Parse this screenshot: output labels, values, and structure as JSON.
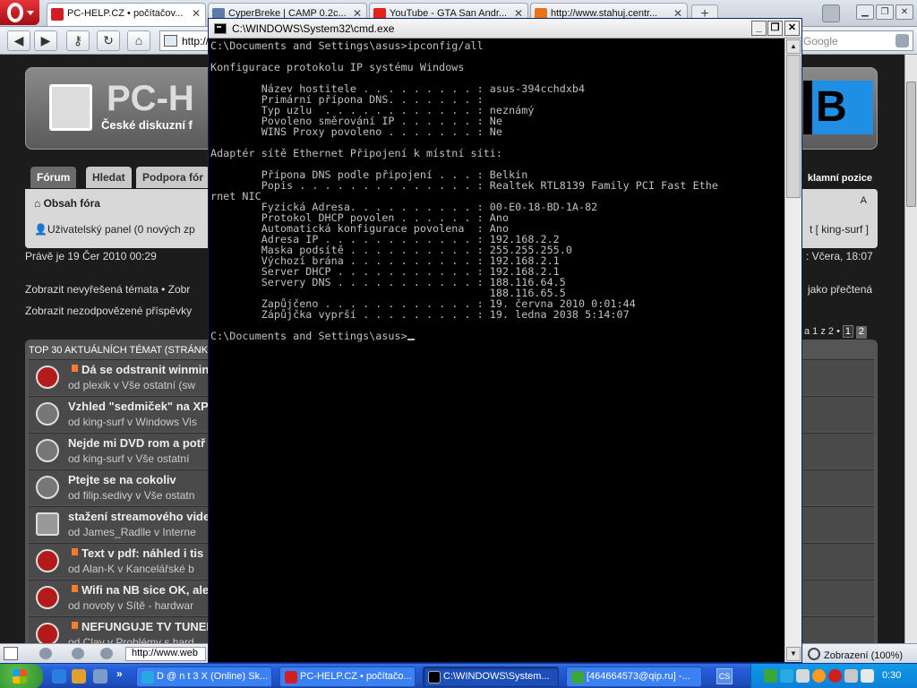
{
  "browser": {
    "tabs": [
      {
        "label": "PC-HELP.CZ • počítačov...",
        "active": true
      },
      {
        "label": "CyperBreke | CAMP 0.2c...",
        "active": false
      },
      {
        "label": "YouTube - GTA San Andr...",
        "active": false
      },
      {
        "label": "http://www.stahuj.centr...",
        "active": false
      }
    ],
    "address": "http://",
    "search_placeholder": "Google",
    "status_url": "http://www.web",
    "zoom": "Zobrazení (100%)"
  },
  "website": {
    "logo_text": "PC-H",
    "slogan": "České diskuzní f",
    "badge_letter": "B",
    "tabs": [
      "Fórum",
      "Hledat",
      "Podpora fór"
    ],
    "ad_position": "klamní pozice",
    "nav_index": "Obsah fóra",
    "font_toggle": "A",
    "user_panel": "Uživatelský panel (0 nových zp",
    "user_name": "t [ king-surf ]",
    "current_time": "Právě je 19 Čer 2010 00:29",
    "last_visit": ": Včera, 18:07",
    "unsolved_link": "Zobrazit nevyřešená témata • Zobr",
    "mark_read": "jako přečtená",
    "unanswered_link": "Zobrazit nezodpovězené příspěvky",
    "pagination_label": "a 1 z 2 •",
    "pages": [
      "1",
      "2"
    ],
    "topics_title": "TOP 30 AKTUÁLNÍCH TÉMAT (STRÁNKA",
    "topics": [
      {
        "title": "Dá se odstranit winmin",
        "meta": "od plexik v Vše ostatní (sw",
        "flag": true,
        "icon": "unread"
      },
      {
        "title": "Vzhled \"sedmiček\" na XP",
        "meta": "od king-surf v Windows Vis",
        "flag": false,
        "icon": "read"
      },
      {
        "title": "Nejde mi DVD rom a potř",
        "meta": "od king-surf v Vše ostatní",
        "flag": false,
        "icon": "read"
      },
      {
        "title": "Ptejte se na cokoliv",
        "meta": "od filip.sedivy v Vše ostatn",
        "flag": false,
        "icon": "read"
      },
      {
        "title": "stažení streamového vide",
        "meta": "od James_Radlle v Interne",
        "flag": false,
        "icon": "disk"
      },
      {
        "title": "Text v pdf: náhled i tis",
        "meta": "od Alan-K v Kancelářské b",
        "flag": true,
        "icon": "unread"
      },
      {
        "title": "Wifi na NB sice OK, ale",
        "meta": "od novoty v Sítě - hardwar",
        "flag": true,
        "icon": "unread"
      },
      {
        "title": "NEFUNGUJE TV TUNER",
        "meta": "od Clay v Problémy s hard",
        "flag": true,
        "icon": "unread"
      }
    ]
  },
  "cmd": {
    "title": "C:\\WINDOWS\\System32\\cmd.exe",
    "lines": [
      "C:\\Documents and Settings\\asus>ipconfig/all",
      "",
      "Konfigurace protokolu IP systému Windows",
      "",
      "        Název hostitele . . . . . . . . . : asus-394cchdxb4",
      "        Primární přípona DNS. . . . . . . :",
      "        Typ uzlu  . . . . . . . . . . . . : neznámý",
      "        Povoleno směrování IP . . . . . . : Ne",
      "        WINS Proxy povoleno . . . . . . . : Ne",
      "",
      "Adaptér sítě Ethernet Připojení k místní síti:",
      "",
      "        Přípona DNS podle připojení . . . : Belkin",
      "        Popis . . . . . . . . . . . . . . : Realtek RTL8139 Family PCI Fast Ethe",
      "rnet NIC",
      "        Fyzická Adresa. . . . . . . . . . : 00-E0-18-BD-1A-82",
      "        Protokol DHCP povolen . . . . . . : Ano",
      "        Automatická konfigurace povolena  : Ano",
      "        Adresa IP . . . . . . . . . . . . : 192.168.2.2",
      "        Maska podsítě . . . . . . . . . . : 255.255.255.0",
      "        Výchozí brána . . . . . . . . . . : 192.168.2.1",
      "        Server DHCP . . . . . . . . . . . : 192.168.2.1",
      "        Servery DNS . . . . . . . . . . . : 188.116.64.5",
      "                                            188.116.65.5",
      "        Zapůjčeno . . . . . . . . . . . . : 19. června 2010 0:01:44",
      "        Zápůjčka vyprší . . . . . . . . . : 19. ledna 2038 5:14:07",
      "",
      "C:\\Documents and Settings\\asus>"
    ]
  },
  "taskbar": {
    "buttons": [
      {
        "label": "D @ n t 3 X (Online) Sk...",
        "active": false,
        "icon_color": "#29a9e1"
      },
      {
        "label": "PC-HELP.CZ • počítačo...",
        "active": false,
        "icon_color": "#d21d23"
      },
      {
        "label": "C:\\WINDOWS\\System...",
        "active": true,
        "icon_color": "#000000"
      },
      {
        "label": "[464664573@qip.ru] -...",
        "active": false,
        "icon_color": "#3aa63a"
      }
    ],
    "lang": "CS",
    "clock": "0:30"
  },
  "colors": {
    "console_bg": "#000000",
    "console_fg": "#c0c0c0",
    "taskbar_blue": "#245edb",
    "opera_red": "#cc1a1f"
  }
}
